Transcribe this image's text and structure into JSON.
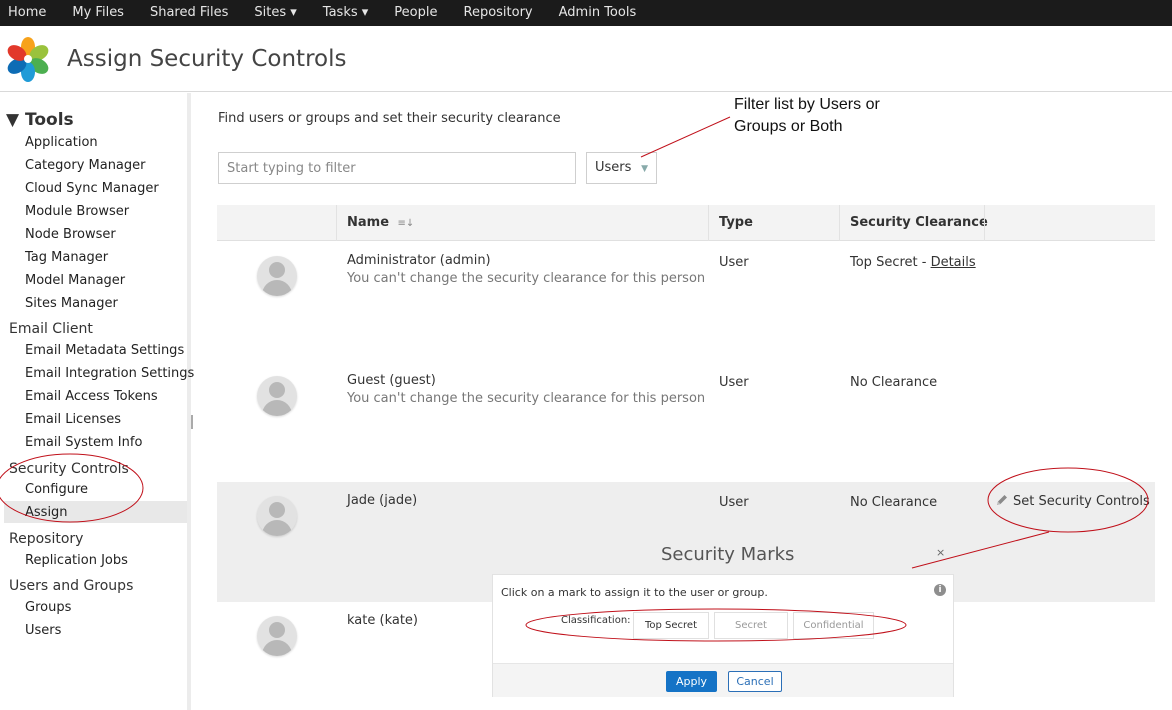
{
  "topnav": [
    "Home",
    "My Files",
    "Shared Files",
    "Sites ▾",
    "Tasks ▾",
    "People",
    "Repository",
    "Admin Tools"
  ],
  "header": {
    "title": "Assign Security Controls"
  },
  "sidebar": {
    "tools_heading": "▼ Tools",
    "tools": [
      "Application",
      "Category Manager",
      "Cloud Sync Manager",
      "Module Browser",
      "Node Browser",
      "Tag Manager",
      "Model Manager",
      "Sites Manager"
    ],
    "email_heading": "Email Client",
    "email": [
      "Email Metadata Settings",
      "Email Integration Settings",
      "Email Access Tokens",
      "Email Licenses",
      "Email System Info"
    ],
    "security_heading": "Security Controls",
    "security": [
      "Configure",
      "Assign"
    ],
    "repository_heading": "Repository",
    "repository": [
      "Replication Jobs"
    ],
    "users_heading": "Users and Groups",
    "users": [
      "Groups",
      "Users"
    ]
  },
  "main": {
    "intro": "Find users or groups and set their security clearance",
    "filter_placeholder": "Start typing to filter",
    "filter_select": "Users",
    "annotation_filter": [
      "Filter list by Users or",
      "Groups or Both"
    ],
    "columns": {
      "name": "Name",
      "type": "Type",
      "clearance": "Security Clearance"
    },
    "rows": [
      {
        "name": "Administrator (admin)",
        "note": "You can't change the security clearance for this person",
        "type": "User",
        "clearance": "Top Secret - ",
        "clearance_link": "Details"
      },
      {
        "name": "Guest (guest)",
        "note": "You can't change the security clearance for this person",
        "type": "User",
        "clearance": "No Clearance"
      },
      {
        "name": "Jade (jade)",
        "type": "User",
        "clearance": "No Clearance",
        "action": "Set Security Controls"
      },
      {
        "name": "kate (kate)"
      }
    ]
  },
  "dialog": {
    "title": "Security Marks",
    "close": "×",
    "instruction": "Click on a mark to assign it to the user or group.",
    "info": "i",
    "classification_label": "Classification:",
    "marks": [
      "Top Secret",
      "Secret",
      "Confidential"
    ],
    "apply": "Apply",
    "cancel": "Cancel"
  },
  "colors": {
    "nav_bg": "#1b1b1b",
    "apply_blue": "#1573c6",
    "annotation_red": "#c0101a",
    "highlight_row": "#eeeeee"
  }
}
